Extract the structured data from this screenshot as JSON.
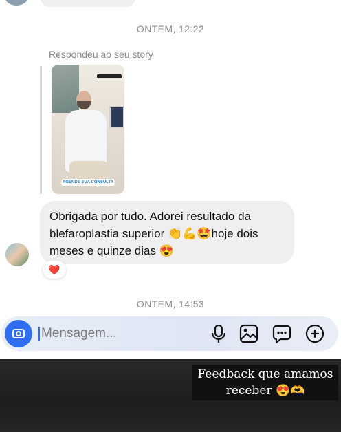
{
  "timestamps": {
    "first": "ONTEM, 12:22",
    "second": "ONTEM, 14:53"
  },
  "story_reply": {
    "note": "Respondeu ao seu story",
    "story_cta": "AGENDE SUA CONSULTA"
  },
  "message": {
    "text": "Obrigada por tudo. Adorei resultado da blefaroplastia superior 👏💪🤩hoje dois meses e quinze dias 😍",
    "reaction": "❤️"
  },
  "composer": {
    "placeholder": "Mensagem...",
    "accent_color": "#2f6ef2",
    "icons": [
      "camera-icon",
      "microphone-icon",
      "gallery-icon",
      "sticker-icon",
      "plus-icon"
    ]
  },
  "overlay_caption": "Feedback que amamos receber 😍🫶"
}
